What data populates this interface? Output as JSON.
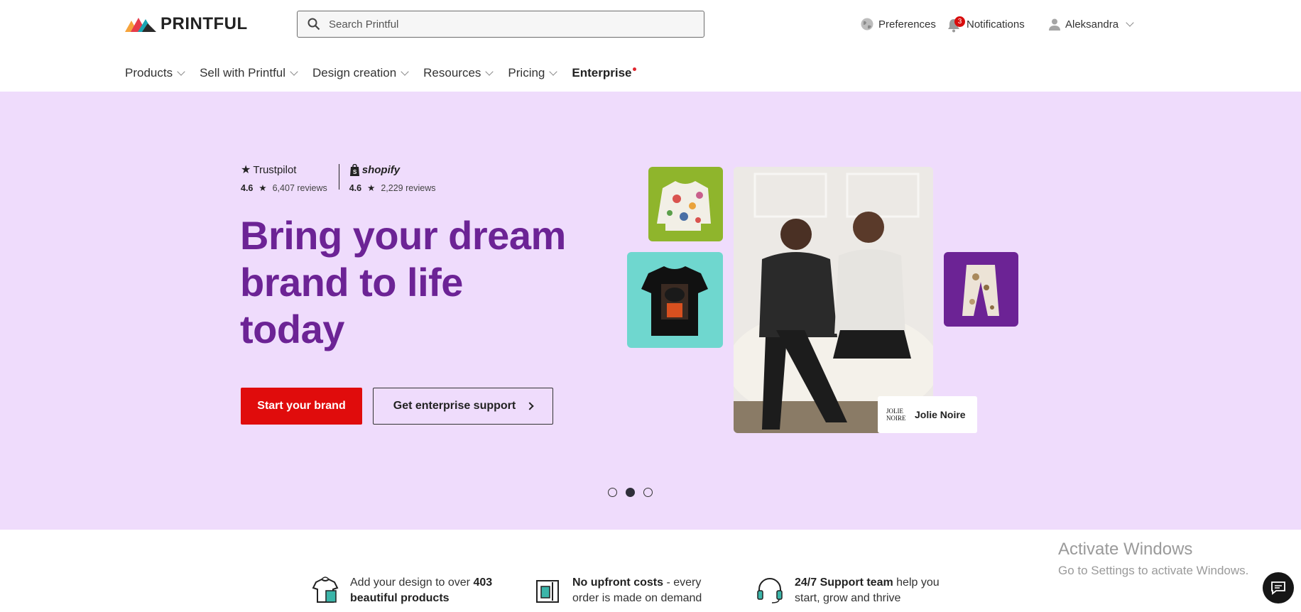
{
  "header": {
    "logo_text": "PRINTFUL",
    "search_placeholder": "Search Printful",
    "preferences_label": "Preferences",
    "notifications_label": "Notifications",
    "notifications_count": "3",
    "user_name": "Aleksandra"
  },
  "nav": {
    "items": [
      {
        "label": "Products"
      },
      {
        "label": "Sell with Printful"
      },
      {
        "label": "Design creation"
      },
      {
        "label": "Resources"
      },
      {
        "label": "Pricing"
      },
      {
        "label": "Enterprise"
      }
    ]
  },
  "hero": {
    "trustpilot": {
      "name": "Trustpilot",
      "score": "4.6",
      "reviews": "6,407 reviews"
    },
    "shopify": {
      "name": "shopify",
      "score": "4.6",
      "reviews": "2,229 reviews"
    },
    "headline": "Bring your dream brand to life today",
    "primary_cta": "Start your brand",
    "secondary_cta": "Get enterprise support",
    "brand_card": {
      "logo_line1": "JOLIE",
      "logo_line2": "NOIRE",
      "name": "Jolie Noire"
    },
    "carousel": {
      "count": 3,
      "active_index": 1
    }
  },
  "features": [
    {
      "text_pre": "Add your design to over ",
      "bold": "403",
      "text_post": "",
      "line2_bold": "beautiful products",
      "line2": ""
    },
    {
      "text_pre": "",
      "bold": "No upfront costs",
      "text_post": " - every",
      "line2_bold": "",
      "line2": "order is made on demand"
    },
    {
      "text_pre": "",
      "bold": "24/7 Support team",
      "text_post": " help you",
      "line2_bold": "",
      "line2": "start, grow and thrive"
    }
  ],
  "watermark": {
    "line1": "Activate Windows",
    "line2": "Go to Settings to activate Windows."
  },
  "colors": {
    "accent_purple": "#6c2395",
    "hero_bg": "#efdcfc",
    "cta_red": "#e00c0c"
  }
}
